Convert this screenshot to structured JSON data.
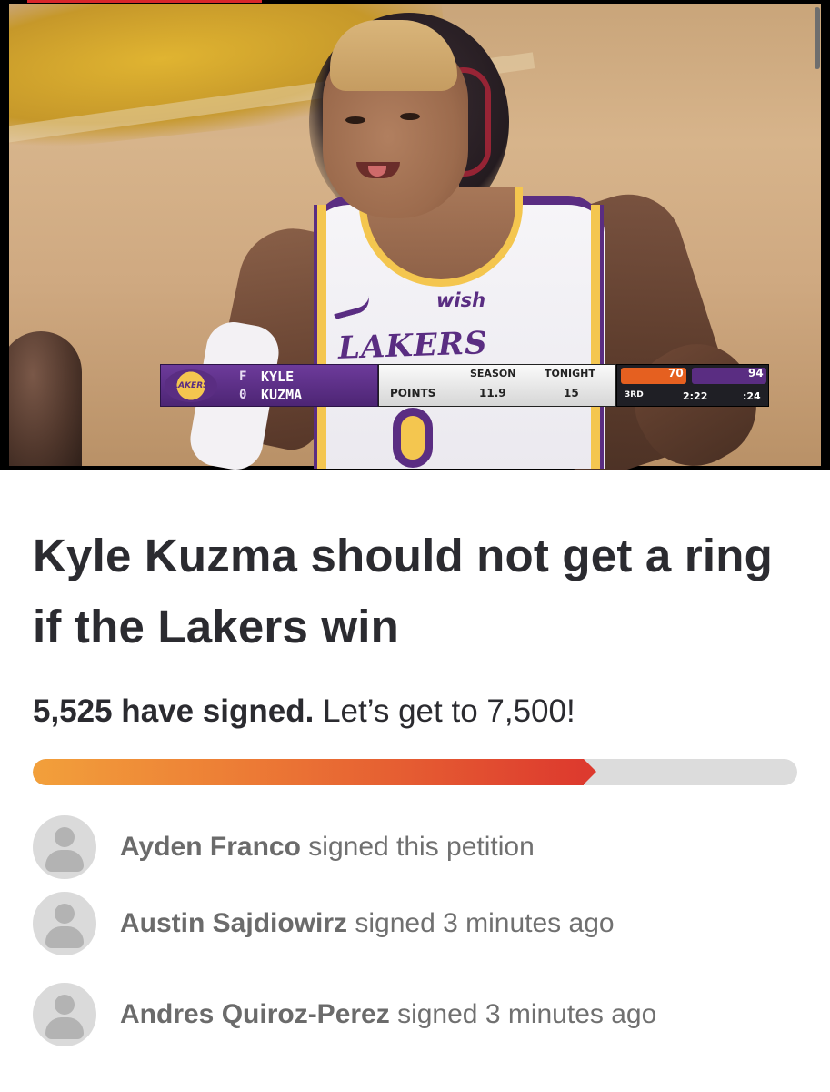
{
  "media": {
    "scoreboard": {
      "player_position": "F\n0",
      "player_first": "KYLE",
      "player_last": "KUZMA",
      "stat_label": "POINTS",
      "season_label": "SEASON",
      "season_value": "11.9",
      "tonight_label": "TONIGHT",
      "tonight_value": "15",
      "team_logo_text": "LAKERS",
      "away_score": "70",
      "home_score": "94",
      "quarter": "3RD",
      "clock": "2:22",
      "shot_clock": ":24"
    },
    "jersey_sponsor": "wish",
    "jersey_name": "LAKERS"
  },
  "petition": {
    "title": "Kyle Kuzma should not get a ring if the Lakers win",
    "signed_count_text": "5,525 have signed.",
    "goal_text": "Let’s get to 7,500!",
    "progress_fraction": 0.7367
  },
  "signers": [
    {
      "name": "Ayden Franco",
      "action": "signed this petition"
    },
    {
      "name": "Austin Sajdiowirz",
      "action": "signed 3 minutes ago"
    },
    {
      "name": "Andres Quiroz-Perez",
      "action": "signed 3 minutes ago"
    }
  ],
  "colors": {
    "progress_start": "#f2a03b",
    "progress_end": "#dd3a2e",
    "progress_track": "#dcdcdc",
    "title_text": "#2b2b30",
    "lakers_purple": "#5a2d82",
    "lakers_gold": "#f4c64f"
  },
  "icons": {
    "avatar": "default-user-icon"
  }
}
